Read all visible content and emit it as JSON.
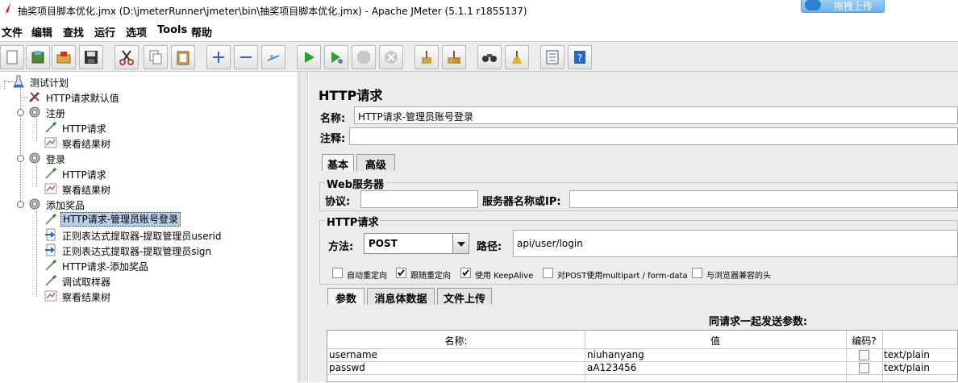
{
  "window": {
    "title": "抽奖项目脚本优化.jmx (D:\\jmeterRunner\\jmeter\\bin\\抽奖项目脚本优化.jmx) - Apache JMeter (5.1.1 r1855137)",
    "upload_label": "拖拽上传"
  },
  "menu": [
    "文件",
    "编辑",
    "查找",
    "运行",
    "选项",
    "Tools",
    "帮助"
  ],
  "tree": [
    {
      "label": "测试计划",
      "icon": "flask-icon"
    },
    {
      "label": "HTTP请求默认值",
      "icon": "wrench-icon"
    },
    {
      "label": "注册",
      "icon": "gear-icon"
    },
    {
      "label": "HTTP请求",
      "icon": "pipette-icon"
    },
    {
      "label": "察看结果树",
      "icon": "chart-icon"
    },
    {
      "label": "登录",
      "icon": "gear-icon"
    },
    {
      "label": "HTTP请求",
      "icon": "pipette-icon"
    },
    {
      "label": "察看结果树",
      "icon": "chart-icon"
    },
    {
      "label": "添加奖品",
      "icon": "gear-icon"
    },
    {
      "label": "HTTP请求-管理员账号登录",
      "icon": "pipette-icon"
    },
    {
      "label": "正则表达式提取器-提取管理员userid",
      "icon": "extractor-icon"
    },
    {
      "label": "正则表达式提取器-提取管理员sign",
      "icon": "extractor-icon"
    },
    {
      "label": "HTTP请求-添加奖品",
      "icon": "pipette-icon"
    },
    {
      "label": "调试取样器",
      "icon": "pipette-icon"
    },
    {
      "label": "察看结果树",
      "icon": "chart-icon"
    }
  ],
  "sampler": {
    "panel_title": "HTTP请求",
    "name_label": "名称:",
    "name_value": "HTTP请求-管理员账号登录",
    "comment_label": "注释:",
    "tabs": [
      "基本",
      "高级"
    ],
    "web_server_group": "Web服务器",
    "protocol_label": "协议:",
    "server_label": "服务器名称或IP:",
    "http_group": "HTTP请求",
    "method_label": "方法:",
    "method_value": "POST",
    "path_label": "路径:",
    "path_value": "api/user/login",
    "checkboxes": [
      {
        "label": "自动重定向",
        "checked": false
      },
      {
        "label": "跟随重定向",
        "checked": true
      },
      {
        "label": "使用 KeepAlive",
        "checked": true
      },
      {
        "label": "对POST使用multipart / form-data",
        "checked": false
      },
      {
        "label": "与浏览器兼容的头",
        "checked": false
      }
    ],
    "param_tabs": [
      "参数",
      "消息体数据",
      "文件上传"
    ],
    "params_title": "同请求一起发送参数:",
    "columns": [
      "名称:",
      "值",
      "编码?",
      ""
    ],
    "rows": [
      {
        "name": "username",
        "value": "niuhanyang",
        "encode": false,
        "content_type": "text/plain"
      },
      {
        "name": "passwd",
        "value": "aA123456",
        "encode": false,
        "content_type": "text/plain"
      }
    ]
  }
}
